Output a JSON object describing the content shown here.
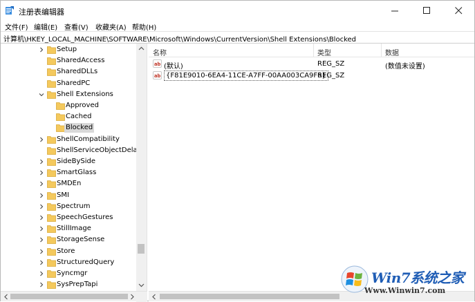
{
  "window": {
    "title": "注册表编辑器",
    "minimize_glyph": "—",
    "maximize_glyph": "☐",
    "close_glyph": "✕"
  },
  "menu": [
    {
      "label": "文件(F)"
    },
    {
      "label": "编辑(E)"
    },
    {
      "label": "查看(V)"
    },
    {
      "label": "收藏夹(A)"
    },
    {
      "label": "帮助(H)"
    }
  ],
  "address": "计算机\\HKEY_LOCAL_MACHINE\\SOFTWARE\\Microsoft\\Windows\\CurrentVersion\\Shell Extensions\\Blocked",
  "tree": {
    "items": [
      {
        "label": "Setup",
        "level": 1,
        "state": "collapsed"
      },
      {
        "label": "SharedAccess",
        "level": 1,
        "state": "none"
      },
      {
        "label": "SharedDLLs",
        "level": 1,
        "state": "none"
      },
      {
        "label": "SharedPC",
        "level": 1,
        "state": "none"
      },
      {
        "label": "Shell Extensions",
        "level": 1,
        "state": "expanded"
      },
      {
        "label": "Approved",
        "level": 2,
        "state": "none"
      },
      {
        "label": "Cached",
        "level": 2,
        "state": "none"
      },
      {
        "label": "Blocked",
        "level": 2,
        "state": "none",
        "selected": true
      },
      {
        "label": "ShellCompatibility",
        "level": 1,
        "state": "collapsed"
      },
      {
        "label": "ShellServiceObjectDelayLoad",
        "level": 1,
        "state": "none"
      },
      {
        "label": "SideBySide",
        "level": 1,
        "state": "collapsed"
      },
      {
        "label": "SmartGlass",
        "level": 1,
        "state": "collapsed"
      },
      {
        "label": "SMDEn",
        "level": 1,
        "state": "collapsed"
      },
      {
        "label": "SMI",
        "level": 1,
        "state": "collapsed"
      },
      {
        "label": "Spectrum",
        "level": 1,
        "state": "collapsed"
      },
      {
        "label": "SpeechGestures",
        "level": 1,
        "state": "collapsed"
      },
      {
        "label": "StillImage",
        "level": 1,
        "state": "collapsed"
      },
      {
        "label": "StorageSense",
        "level": 1,
        "state": "collapsed"
      },
      {
        "label": "Store",
        "level": 1,
        "state": "collapsed"
      },
      {
        "label": "StructuredQuery",
        "level": 1,
        "state": "collapsed"
      },
      {
        "label": "Syncmgr",
        "level": 1,
        "state": "collapsed"
      },
      {
        "label": "SysPrepTapi",
        "level": 1,
        "state": "collapsed"
      }
    ]
  },
  "list": {
    "headers": {
      "name": "名称",
      "type": "类型",
      "data": "数据"
    },
    "rows": [
      {
        "name": "(默认)",
        "type": "REG_SZ",
        "data": "(数值未设置)",
        "icon": "ab"
      },
      {
        "name": "{F81E9010-6EA4-11CE-A7FF-00AA003CA9F6}",
        "type": "REG_SZ",
        "data": "",
        "icon": "ab",
        "editing": true
      }
    ]
  },
  "watermark": {
    "text": "Win7系统之家",
    "url": "Www.Winwin7.com"
  },
  "colors": {
    "folder": "#f4c95d",
    "selection": "#d9d9d9",
    "string_icon": "#c0392b",
    "watermark_text": "#1f5db5"
  }
}
